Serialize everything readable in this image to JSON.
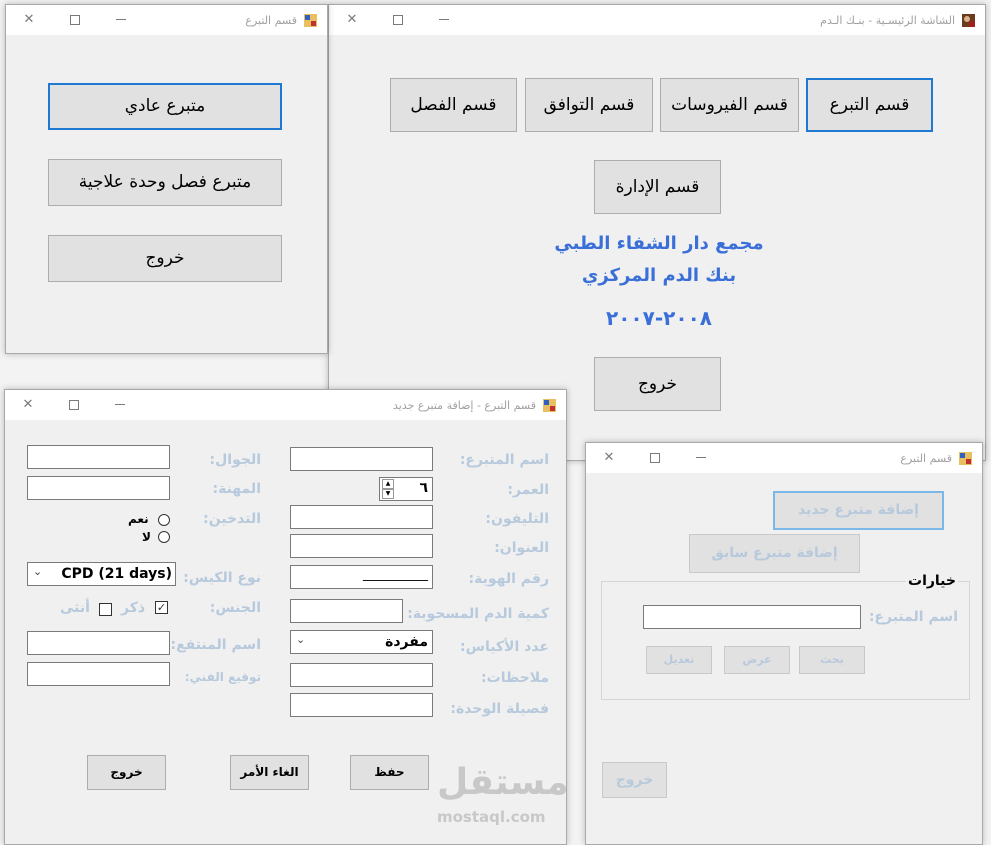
{
  "main_window": {
    "title": "الشاشة الرئيسـية - بنـك الـدم",
    "buttons": {
      "donation": "قسم التبرع",
      "viruses": "قسم الفيروسات",
      "compat": "قسم التوافق",
      "separation": "قسم الفصل",
      "admin": "قسم الإدارة",
      "exit": "خروج"
    },
    "org_name": "مجمع دار الشفاء الطبي",
    "bank_name": "بنك الدم المركزي",
    "years": "٢٠٠٨-٢٠٠٧"
  },
  "donation_type_window": {
    "title": "قسم التبرع",
    "buttons": {
      "regular": "متبرع عادي",
      "therapeutic": "متبرع فصل وحدة علاجية",
      "exit": "خروج"
    }
  },
  "add_donor_window": {
    "title": "قسم التبرع - إضافة متبرع جديد",
    "labels": {
      "donor_name": "اسم المتبرع:",
      "age": "العمر:",
      "phone": "التليفون:",
      "address": "العنوان:",
      "id_number": "رقم الهوية:",
      "blood_amount": "كمية الدم المسحوبة:",
      "bag_count": "عدد الأكياس:",
      "notes": "ملاحظات:",
      "blood_type": "فصيلة الوحدة:",
      "mobile": "الجوال:",
      "job": "المهنة:",
      "smoking": "التدخين:",
      "bag_type": "نوع الكيس:",
      "gender": "الجنس:",
      "recipient": "اسم المنتفع:",
      "tech_signature": "توقيع الفني:"
    },
    "values": {
      "age": "٦",
      "id_mask": "__________",
      "bag_count": "مفردة",
      "bag_type": "CPD (21 days)"
    },
    "options": {
      "yes": "نعم",
      "no": "لا",
      "male": "ذكر",
      "female": "أنثى"
    },
    "checkmark": "✓",
    "buttons": {
      "save": "حفظ",
      "cancel": "الغاء الأمر",
      "exit": "خروج"
    }
  },
  "donor_section_window": {
    "title": "قسم التبرع",
    "buttons": {
      "add_new": "إضافة متبرع جديد",
      "add_previous": "إضافة متبرع سابق",
      "search": "بحث",
      "view": "عرض",
      "edit": "تعديل",
      "exit": "خروج"
    },
    "options_title": "خيارات",
    "donor_name_label": "اسم المتبرع:"
  },
  "watermark": {
    "arabic": "مستقل",
    "latin": "mostaql.com"
  },
  "colors": {
    "accent": "#1f78d1",
    "heading": "#3a6fd8",
    "disabled_text": "#b7c9dc"
  }
}
